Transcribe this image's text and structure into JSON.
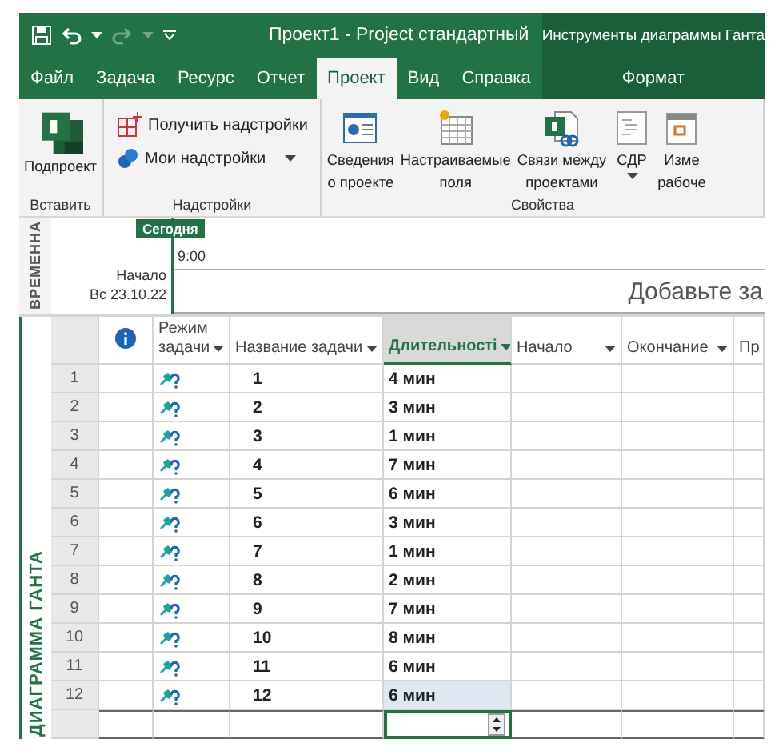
{
  "window": {
    "title": "Проект1  -  Project стандартный",
    "context_title": "Инструменты диаграммы Ганта"
  },
  "tabs": [
    {
      "label": "Файл",
      "selected": false
    },
    {
      "label": "Задача",
      "selected": false
    },
    {
      "label": "Ресурс",
      "selected": false
    },
    {
      "label": "Отчет",
      "selected": false
    },
    {
      "label": "Проект",
      "selected": true
    },
    {
      "label": "Вид",
      "selected": false
    },
    {
      "label": "Справка",
      "selected": false
    }
  ],
  "context_tab": {
    "label": "Формат",
    "selected": false
  },
  "ribbon": [
    {
      "label": "Вставить",
      "buttons": [
        {
          "kind": "large",
          "lines": [
            "Подпроект"
          ],
          "dropdown": false
        }
      ]
    },
    {
      "label": "Надстройки",
      "buttons": [
        {
          "kind": "small",
          "lines": [
            "Получить надстройки"
          ],
          "dropdown": false
        },
        {
          "kind": "small",
          "lines": [
            "Мои надстройки"
          ],
          "dropdown": true
        }
      ]
    },
    {
      "label": "Свойства",
      "buttons": [
        {
          "kind": "large",
          "lines": [
            "Сведения",
            "о проекте"
          ],
          "dropdown": false
        },
        {
          "kind": "large",
          "lines": [
            "Настраиваемые",
            "поля"
          ],
          "dropdown": false
        },
        {
          "kind": "large",
          "lines": [
            "Связи между",
            "проектами"
          ],
          "dropdown": false
        },
        {
          "kind": "large",
          "lines": [
            "СДР"
          ],
          "dropdown": true
        },
        {
          "kind": "large",
          "lines": [
            "Изме",
            "рабоче"
          ],
          "dropdown": false
        }
      ]
    }
  ],
  "timeline": {
    "side_label": "ВРЕМЕННА",
    "today": "Сегодня",
    "time": "9:00",
    "start_label": "Начало",
    "start_date": "Вс 23.10.22",
    "hint": "Добавьте за"
  },
  "table": {
    "side_label": "ДИАГРАММА ГАНТА",
    "columns": [
      {
        "kind": "info",
        "selected": false
      },
      {
        "kind": "text",
        "label": "Режим задачи",
        "dropdown": true,
        "selected": false
      },
      {
        "kind": "text",
        "label": "Название задачи",
        "dropdown": true,
        "selected": false
      },
      {
        "kind": "text",
        "label": "Длительності",
        "dropdown": true,
        "selected": true
      },
      {
        "kind": "text",
        "label": "Начало",
        "dropdown": true,
        "selected": false
      },
      {
        "kind": "text",
        "label": "Окончание",
        "dropdown": true,
        "selected": false
      },
      {
        "kind": "text",
        "label": "Пр",
        "selected": false
      }
    ],
    "rows": [
      {
        "id": "1",
        "name": "1",
        "duration": "4 мин",
        "selected": false
      },
      {
        "id": "2",
        "name": "2",
        "duration": "3 мин",
        "selected": false
      },
      {
        "id": "3",
        "name": "3",
        "duration": "1 мин",
        "selected": false
      },
      {
        "id": "4",
        "name": "4",
        "duration": "7 мин",
        "selected": false
      },
      {
        "id": "5",
        "name": "5",
        "duration": "6 мин",
        "selected": false
      },
      {
        "id": "6",
        "name": "6",
        "duration": "3 мин",
        "selected": false
      },
      {
        "id": "7",
        "name": "7",
        "duration": "1 мин",
        "selected": false
      },
      {
        "id": "8",
        "name": "8",
        "duration": "2 мин",
        "selected": false
      },
      {
        "id": "9",
        "name": "9",
        "duration": "7 мин",
        "selected": false
      },
      {
        "id": "10",
        "name": "10",
        "duration": "8 мин",
        "selected": false
      },
      {
        "id": "11",
        "name": "11",
        "duration": "6 мин",
        "selected": false
      },
      {
        "id": "12",
        "name": "12",
        "duration": "6 мин",
        "selected": true
      }
    ],
    "new_row": {
      "editing": true
    }
  }
}
